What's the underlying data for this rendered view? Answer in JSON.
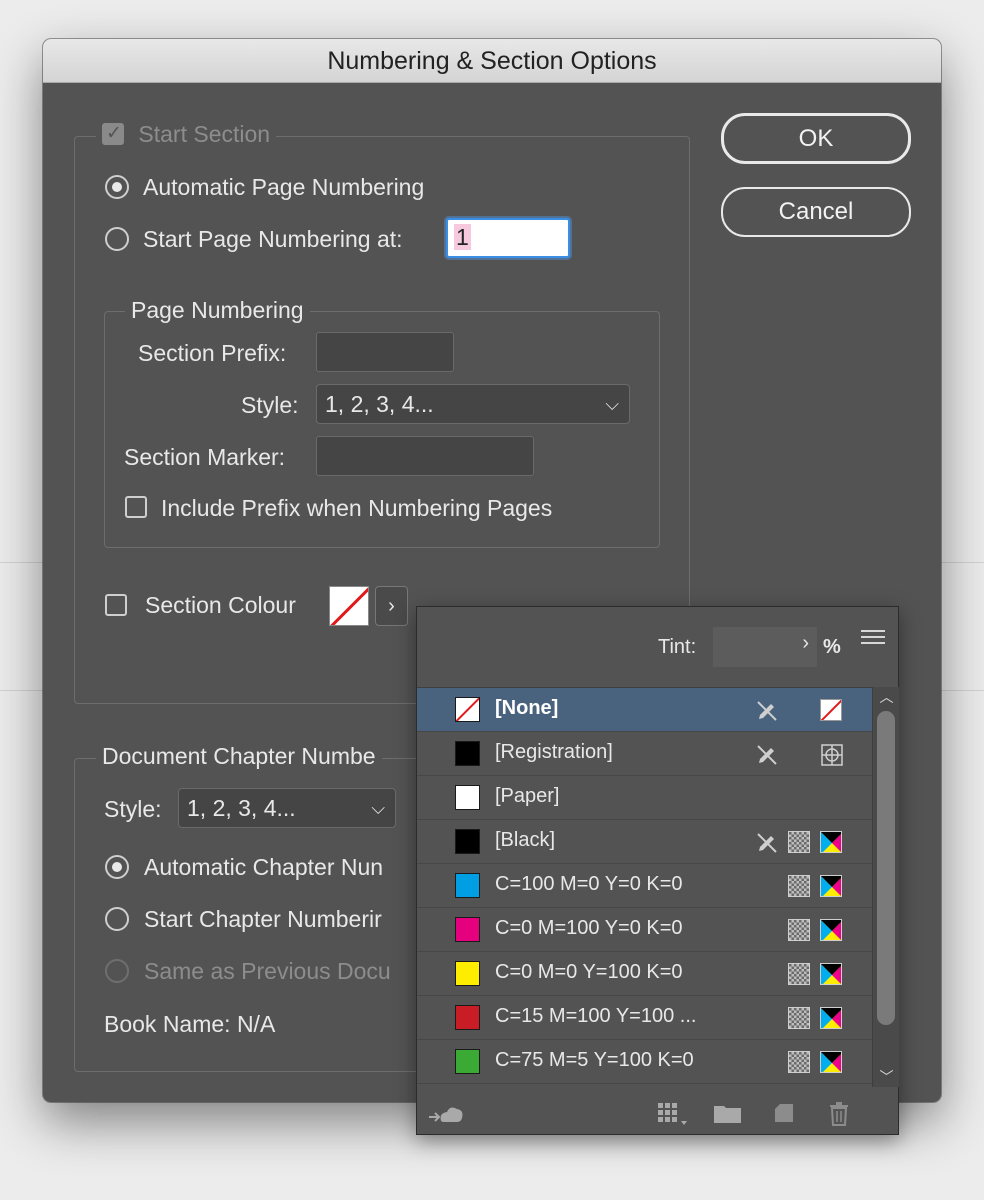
{
  "window": {
    "title": "Numbering & Section Options"
  },
  "buttons": {
    "ok": "OK",
    "cancel": "Cancel"
  },
  "section": {
    "start_section_label": "Start Section",
    "automatic_page_numbering": "Automatic Page Numbering",
    "start_page_numbering_at": "Start Page Numbering at:",
    "start_page_value": "1"
  },
  "page_numbering": {
    "legend": "Page Numbering",
    "section_prefix_label": "Section Prefix:",
    "section_prefix_value": "",
    "style_label": "Style:",
    "style_value": "1, 2, 3, 4...",
    "section_marker_label": "Section Marker:",
    "section_marker_value": "",
    "include_prefix_label": "Include Prefix when Numbering Pages"
  },
  "section_colour": {
    "label": "Section Colour"
  },
  "chapter": {
    "legend": "Document Chapter Numbe",
    "style_label": "Style:",
    "style_value": "1, 2, 3, 4...",
    "automatic": "Automatic Chapter Nun",
    "start": "Start Chapter Numberir",
    "same_as_previous": "Same as Previous Docu",
    "book_name": "Book Name: N/A"
  },
  "swatches": {
    "tint_label": "Tint:",
    "tint_value": "",
    "percent": "%",
    "items": [
      {
        "name": "[None]",
        "color": "none"
      },
      {
        "name": "[Registration]",
        "color": "#000000"
      },
      {
        "name": "[Paper]",
        "color": "#ffffff"
      },
      {
        "name": "[Black]",
        "color": "#000000"
      },
      {
        "name": "C=100 M=0 Y=0 K=0",
        "color": "#009fe3"
      },
      {
        "name": "C=0 M=100 Y=0 K=0",
        "color": "#e5007d"
      },
      {
        "name": "C=0 M=0 Y=100 K=0",
        "color": "#ffed00"
      },
      {
        "name": "C=15 M=100 Y=100 ...",
        "color": "#c81d25"
      },
      {
        "name": "C=75 M=5 Y=100 K=0",
        "color": "#3aaa35"
      }
    ]
  }
}
